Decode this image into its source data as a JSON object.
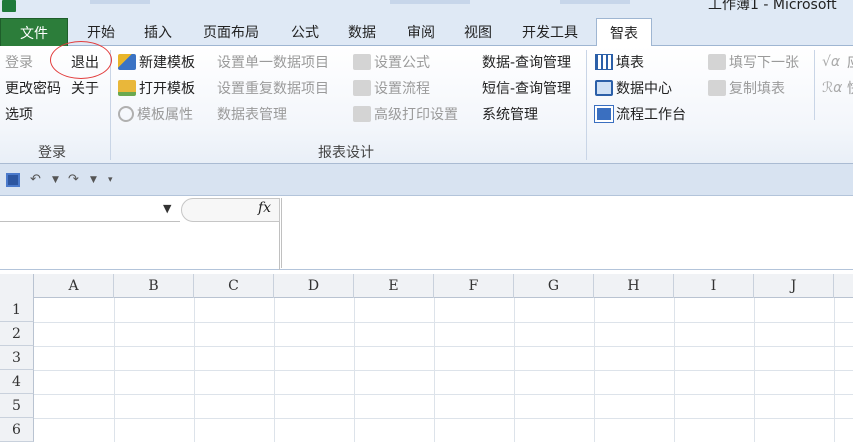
{
  "window": {
    "title": "工作簿1 - Microsoft"
  },
  "tabs": [
    {
      "label": "文件"
    },
    {
      "label": "开始"
    },
    {
      "label": "插入"
    },
    {
      "label": "页面布局"
    },
    {
      "label": "公式"
    },
    {
      "label": "数据"
    },
    {
      "label": "审阅"
    },
    {
      "label": "视图"
    },
    {
      "label": "开发工具"
    },
    {
      "label": "智表"
    }
  ],
  "ribbon": {
    "login_group": {
      "label": "登录",
      "login": "登录",
      "logout": "退出",
      "change_password": "更改密码",
      "about": "关于",
      "options": "选项"
    },
    "report_group": {
      "label": "报表设计",
      "new_template": "新建模板",
      "open_template": "打开模板",
      "template_props": "模板属性",
      "set_single_item": "设置单一数据项目",
      "set_repeat_item": "设置重复数据项目",
      "data_table_mgmt": "数据表管理",
      "set_formula": "设置公式",
      "set_flow": "设置流程",
      "advanced_print": "高级打印设置",
      "data_query_mgmt": "数据-查询管理",
      "sms_query_mgmt": "短信-查询管理",
      "system_mgmt": "系统管理"
    },
    "fill_group": {
      "fill": "填表",
      "data_center": "数据中心",
      "workflow": "流程工作台",
      "next_sheet": "填写下一张",
      "copy_fill": "复制填表",
      "cut_1": "应",
      "cut_2": "快"
    }
  },
  "formula_bar": {
    "fx": "fx"
  },
  "sheet": {
    "columns": [
      "A",
      "B",
      "C",
      "D",
      "E",
      "F",
      "G",
      "H",
      "I",
      "J"
    ],
    "rows": [
      "1",
      "2",
      "3",
      "4",
      "5",
      "6"
    ]
  }
}
